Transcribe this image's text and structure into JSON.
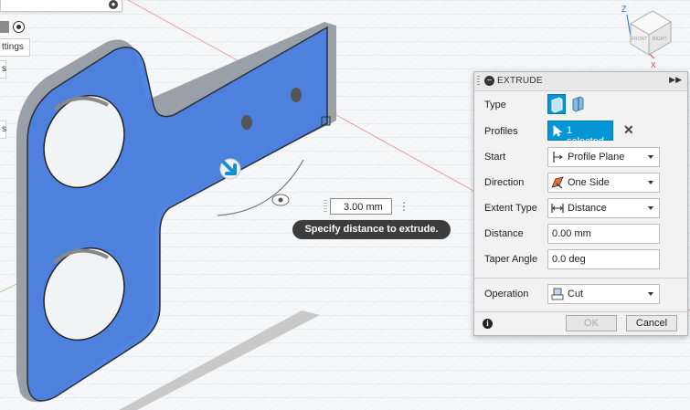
{
  "left_panel": {
    "settings_fragment": "ttings",
    "tab_fragment_1": "s",
    "tab_fragment_2": "s"
  },
  "canvas": {
    "distance_input_value": "3.00 mm",
    "tooltip": "Specify distance to extrude."
  },
  "viewcube": {
    "axis_z": "Z",
    "axis_x": "X",
    "face_front": "FRONT",
    "face_right": "RIGHT"
  },
  "dialog": {
    "title": "EXTRUDE",
    "rows": {
      "type_label": "Type",
      "profiles_label": "Profiles",
      "profiles_value": "1 selected",
      "start_label": "Start",
      "start_value": "Profile Plane",
      "direction_label": "Direction",
      "direction_value": "One Side",
      "extent_label": "Extent Type",
      "extent_value": "Distance",
      "distance_label": "Distance",
      "distance_value": "0.00 mm",
      "taper_label": "Taper Angle",
      "taper_value": "0.0 deg",
      "operation_label": "Operation",
      "operation_value": "Cut"
    },
    "ok_label": "OK",
    "cancel_label": "Cancel"
  },
  "colors": {
    "accent": "#0696d7",
    "body_blue": "#4a7fe0",
    "body_edge": "#2a2f3a"
  }
}
